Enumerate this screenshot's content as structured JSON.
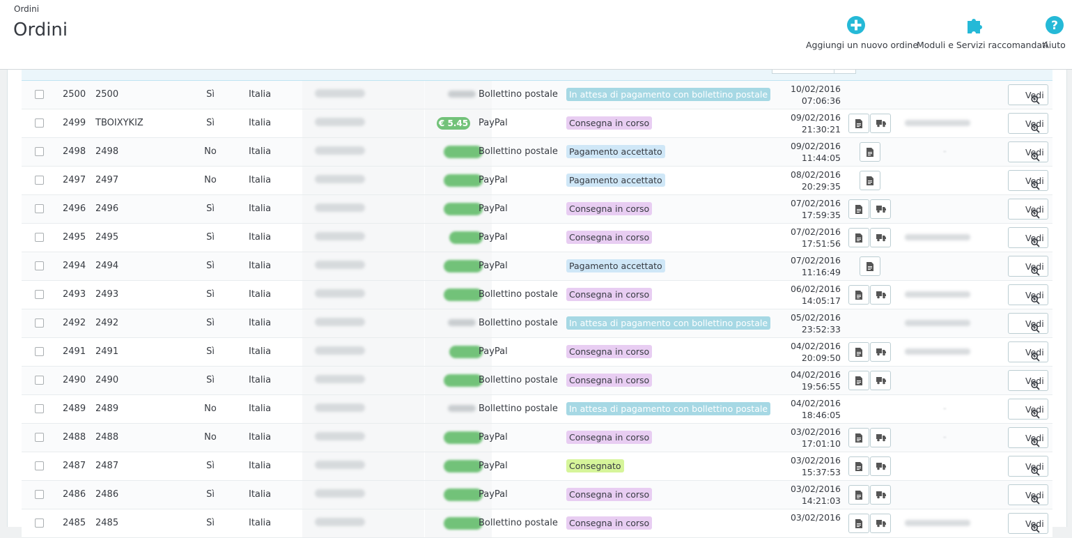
{
  "breadcrumb": "Ordini",
  "page_title": "Ordini",
  "toolbar": {
    "add_label": "Aggiungi un nuovo ordine",
    "modules_label": "Moduli e Servizi raccomandati",
    "help_label": "Aiuto"
  },
  "colors": {
    "accent": "#25b9d7",
    "status_waiting": "#a6d8e4",
    "status_shipping": "#e8cdf2",
    "status_accepted": "#cfe7f7",
    "status_delivered": "#d6f59a",
    "total_pill": "#72c279"
  },
  "view_label": "Vedi",
  "orders": [
    {
      "id": "2500",
      "reference": "2500",
      "new_client": "Sì",
      "country": "Italia",
      "total": "",
      "payment": "Bollettino postale",
      "status": "In attesa di pagamento con bollettino postale",
      "status_kind": "wait",
      "date": "10/02/2016",
      "time": "07:06:36",
      "invoice": false,
      "delivery": false,
      "tracking": "none"
    },
    {
      "id": "2499",
      "reference": "TBOIXYKIZ",
      "new_client": "Sì",
      "country": "Italia",
      "total": "€ 5.45",
      "payment": "PayPal",
      "status": "Consegna in corso",
      "status_kind": "ship",
      "date": "09/02/2016",
      "time": "21:30:21",
      "invoice": true,
      "delivery": true,
      "tracking": "blur"
    },
    {
      "id": "2498",
      "reference": "2498",
      "new_client": "No",
      "country": "Italia",
      "total": "",
      "payment": "Bollettino postale",
      "status": "Pagamento accettato",
      "status_kind": "acc",
      "date": "09/02/2016",
      "time": "11:44:05",
      "invoice": true,
      "delivery": false,
      "tracking": "dash"
    },
    {
      "id": "2497",
      "reference": "2497",
      "new_client": "No",
      "country": "Italia",
      "total": "",
      "payment": "PayPal",
      "status": "Pagamento accettato",
      "status_kind": "acc",
      "date": "08/02/2016",
      "time": "20:29:35",
      "invoice": true,
      "delivery": false,
      "tracking": "none"
    },
    {
      "id": "2496",
      "reference": "2496",
      "new_client": "Sì",
      "country": "Italia",
      "total": "",
      "payment": "PayPal",
      "status": "Consegna in corso",
      "status_kind": "ship",
      "date": "07/02/2016",
      "time": "17:59:35",
      "invoice": true,
      "delivery": true,
      "tracking": "none"
    },
    {
      "id": "2495",
      "reference": "2495",
      "new_client": "Sì",
      "country": "Italia",
      "total": "",
      "payment": "PayPal",
      "status": "Consegna in corso",
      "status_kind": "ship",
      "date": "07/02/2016",
      "time": "17:51:56",
      "invoice": true,
      "delivery": true,
      "tracking": "blur"
    },
    {
      "id": "2494",
      "reference": "2494",
      "new_client": "Sì",
      "country": "Italia",
      "total": "",
      "payment": "PayPal",
      "status": "Pagamento accettato",
      "status_kind": "acc",
      "date": "07/02/2016",
      "time": "11:16:49",
      "invoice": true,
      "delivery": false,
      "tracking": "none"
    },
    {
      "id": "2493",
      "reference": "2493",
      "new_client": "Sì",
      "country": "Italia",
      "total": "",
      "payment": "Bollettino postale",
      "status": "Consegna in corso",
      "status_kind": "ship",
      "date": "06/02/2016",
      "time": "14:05:17",
      "invoice": true,
      "delivery": true,
      "tracking": "blur"
    },
    {
      "id": "2492",
      "reference": "2492",
      "new_client": "Sì",
      "country": "Italia",
      "total": "",
      "payment": "Bollettino postale",
      "status": "In attesa di pagamento con bollettino postale",
      "status_kind": "wait",
      "date": "05/02/2016",
      "time": "23:52:33",
      "invoice": false,
      "delivery": false,
      "tracking": "blur"
    },
    {
      "id": "2491",
      "reference": "2491",
      "new_client": "Sì",
      "country": "Italia",
      "total": "",
      "payment": "PayPal",
      "status": "Consegna in corso",
      "status_kind": "ship",
      "date": "04/02/2016",
      "time": "20:09:50",
      "invoice": true,
      "delivery": true,
      "tracking": "blur"
    },
    {
      "id": "2490",
      "reference": "2490",
      "new_client": "Sì",
      "country": "Italia",
      "total": "",
      "payment": "Bollettino postale",
      "status": "Consegna in corso",
      "status_kind": "ship",
      "date": "04/02/2016",
      "time": "19:56:55",
      "invoice": true,
      "delivery": true,
      "tracking": "none"
    },
    {
      "id": "2489",
      "reference": "2489",
      "new_client": "No",
      "country": "Italia",
      "total": "",
      "payment": "Bollettino postale",
      "status": "In attesa di pagamento con bollettino postale",
      "status_kind": "wait",
      "date": "04/02/2016",
      "time": "18:46:05",
      "invoice": false,
      "delivery": false,
      "tracking": "dash"
    },
    {
      "id": "2488",
      "reference": "2488",
      "new_client": "No",
      "country": "Italia",
      "total": "",
      "payment": "PayPal",
      "status": "Consegna in corso",
      "status_kind": "ship",
      "date": "03/02/2016",
      "time": "17:01:10",
      "invoice": true,
      "delivery": true,
      "tracking": "dash"
    },
    {
      "id": "2487",
      "reference": "2487",
      "new_client": "Sì",
      "country": "Italia",
      "total": "",
      "payment": "PayPal",
      "status": "Consegnato",
      "status_kind": "done",
      "date": "03/02/2016",
      "time": "15:37:53",
      "invoice": true,
      "delivery": true,
      "tracking": "none"
    },
    {
      "id": "2486",
      "reference": "2486",
      "new_client": "Sì",
      "country": "Italia",
      "total": "",
      "payment": "PayPal",
      "status": "Consegna in corso",
      "status_kind": "ship",
      "date": "03/02/2016",
      "time": "14:21:03",
      "invoice": true,
      "delivery": true,
      "tracking": "none"
    },
    {
      "id": "2485",
      "reference": "2485",
      "new_client": "Sì",
      "country": "Italia",
      "total": "",
      "payment": "Bollettino postale",
      "status": "Consegna in corso",
      "status_kind": "ship",
      "date": "03/02/2016",
      "time": "",
      "invoice": true,
      "delivery": true,
      "tracking": "blur"
    }
  ]
}
